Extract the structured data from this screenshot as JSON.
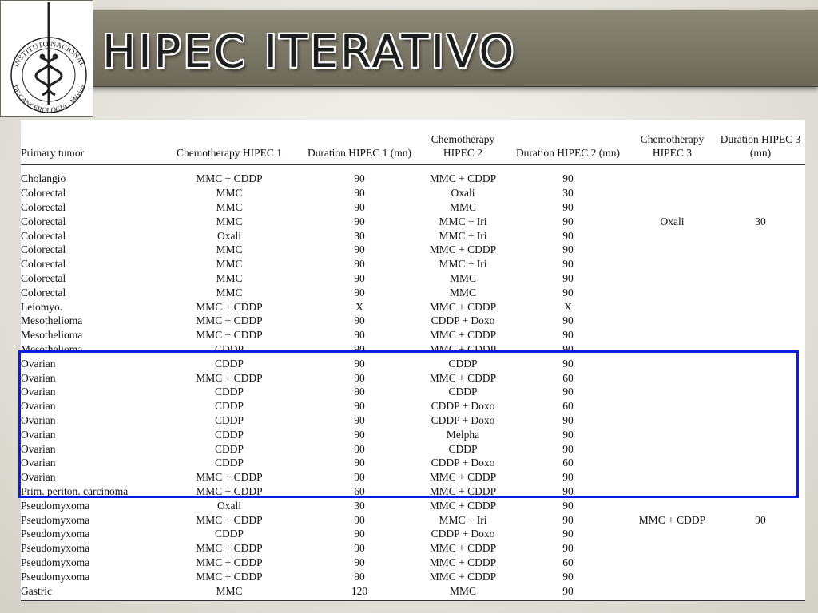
{
  "slide": {
    "title": "HIPEC  ITERATIVO"
  },
  "logo": {
    "top_text": "INSTITUTO NACIONAL",
    "bottom_text": "DE CANCEROLOGIA · México",
    "icon": "caduceus-icon"
  },
  "table": {
    "headers": [
      "Primary tumor",
      "Chemotherapy HIPEC 1",
      "Duration HIPEC 1 (mn)",
      "Chemotherapy HIPEC 2",
      "Duration HIPEC 2 (mn)",
      "Chemotherapy HIPEC 3",
      "Duration HIPEC 3 (mn)"
    ],
    "rows": [
      [
        "Cholangio",
        "MMC + CDDP",
        "90",
        "MMC + CDDP",
        "90",
        "",
        ""
      ],
      [
        "Colorectal",
        "MMC",
        "90",
        "Oxali",
        "30",
        "",
        ""
      ],
      [
        "Colorectal",
        "MMC",
        "90",
        "MMC",
        "90",
        "",
        ""
      ],
      [
        "Colorectal",
        "MMC",
        "90",
        "MMC + Iri",
        "90",
        "Oxali",
        "30"
      ],
      [
        "Colorectal",
        "Oxali",
        "30",
        "MMC + Iri",
        "90",
        "",
        ""
      ],
      [
        "Colorectal",
        "MMC",
        "90",
        "MMC + CDDP",
        "90",
        "",
        ""
      ],
      [
        "Colorectal",
        "MMC",
        "90",
        "MMC + Iri",
        "90",
        "",
        ""
      ],
      [
        "Colorectal",
        "MMC",
        "90",
        "MMC",
        "90",
        "",
        ""
      ],
      [
        "Colorectal",
        "MMC",
        "90",
        "MMC",
        "90",
        "",
        ""
      ],
      [
        "Leiomyo.",
        "MMC + CDDP",
        "X",
        "MMC + CDDP",
        "X",
        "",
        ""
      ],
      [
        "Mesothelioma",
        "MMC + CDDP",
        "90",
        "CDDP + Doxo",
        "90",
        "",
        ""
      ],
      [
        "Mesothelioma",
        "MMC + CDDP",
        "90",
        "MMC + CDDP",
        "90",
        "",
        ""
      ],
      [
        "Mesothelioma",
        "CDDP",
        "90",
        "MMC + CDDP",
        "90",
        "",
        ""
      ],
      [
        "Ovarian",
        "CDDP",
        "90",
        "CDDP",
        "90",
        "",
        ""
      ],
      [
        "Ovarian",
        "MMC + CDDP",
        "90",
        "MMC + CDDP",
        "60",
        "",
        ""
      ],
      [
        "Ovarian",
        "CDDP",
        "90",
        "CDDP",
        "90",
        "",
        ""
      ],
      [
        "Ovarian",
        "CDDP",
        "90",
        "CDDP + Doxo",
        "60",
        "",
        ""
      ],
      [
        "Ovarian",
        "CDDP",
        "90",
        "CDDP + Doxo",
        "90",
        "",
        ""
      ],
      [
        "Ovarian",
        "CDDP",
        "90",
        "Melpha",
        "90",
        "",
        ""
      ],
      [
        "Ovarian",
        "CDDP",
        "90",
        "CDDP",
        "90",
        "",
        ""
      ],
      [
        "Ovarian",
        "CDDP",
        "90",
        "CDDP + Doxo",
        "60",
        "",
        ""
      ],
      [
        "Ovarian",
        "MMC + CDDP",
        "90",
        "MMC + CDDP",
        "90",
        "",
        ""
      ],
      [
        "Prim. periton. carcinoma",
        "MMC + CDDP",
        "60",
        "MMC + CDDP",
        "90",
        "",
        ""
      ],
      [
        "Pseudomyxoma",
        "Oxali",
        "30",
        "MMC + CDDP",
        "90",
        "",
        ""
      ],
      [
        "Pseudomyxoma",
        "MMC + CDDP",
        "90",
        "MMC + Iri",
        "90",
        "MMC + CDDP",
        "90"
      ],
      [
        "Pseudomyxoma",
        "CDDP",
        "90",
        "CDDP + Doxo",
        "90",
        "",
        ""
      ],
      [
        "Pseudomyxoma",
        "MMC + CDDP",
        "90",
        "MMC + CDDP",
        "90",
        "",
        ""
      ],
      [
        "Pseudomyxoma",
        "MMC + CDDP",
        "90",
        "MMC + CDDP",
        "60",
        "",
        ""
      ],
      [
        "Pseudomyxoma",
        "MMC + CDDP",
        "90",
        "MMC + CDDP",
        "90",
        "",
        ""
      ],
      [
        "Gastric",
        "MMC",
        "120",
        "MMC",
        "90",
        "",
        ""
      ]
    ]
  },
  "highlight": {
    "color": "#0b1ee0",
    "label": "Ovarian and primary peritoneal carcinoma rows"
  },
  "colors": {
    "title_bar": "#7b7766",
    "background": "#e9e7e1"
  }
}
